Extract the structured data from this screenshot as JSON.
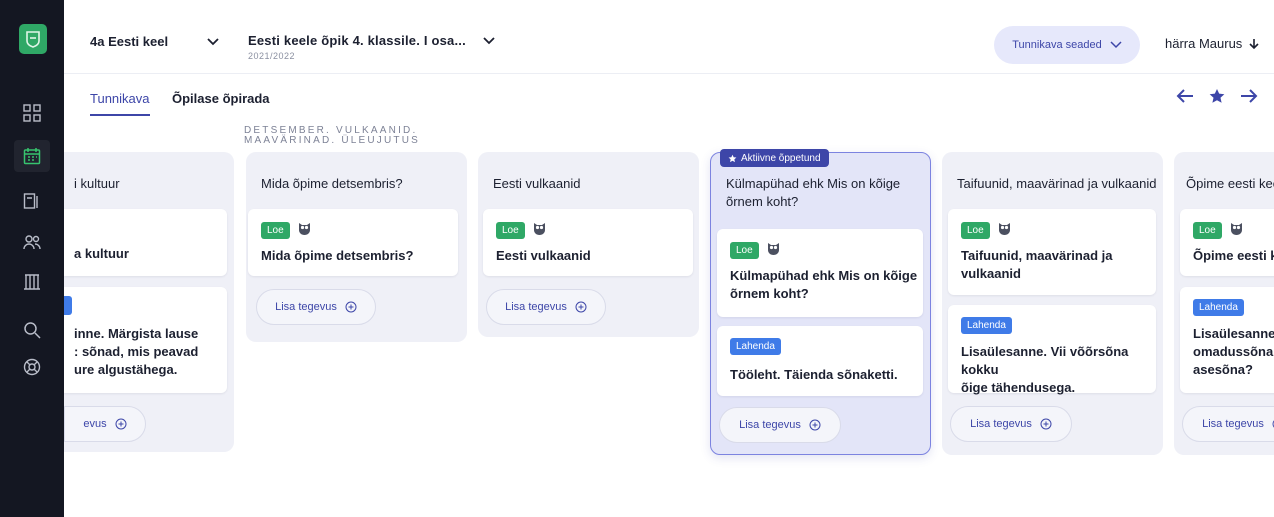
{
  "header": {
    "course": "4a Eesti keel",
    "book_title": "Eesti keele õpik 4. klassile. I osa...",
    "book_year": "2021/2022",
    "settings_label": "Tunnikava seaded",
    "user": "härra Maurus"
  },
  "tabs": [
    "Tunnikava",
    "Õpilase õpirada"
  ],
  "section_label_line1": "DETSEMBER. VULKAANID.",
  "section_label_line2": "MAAVÄRINAD. ÜLEUJUTUS",
  "active_badge": "Aktiivne õppetund",
  "add_label": "Lisa tegevus",
  "tags": {
    "read": "Loe",
    "solve": "Lahenda"
  },
  "columns": [
    {
      "title": "i kultuur",
      "cards": [
        {
          "tag": "",
          "text": "a kultuur"
        },
        {
          "tag": "Lahenda",
          "text_lines": [
            "inne. Märgista lause",
            ": sõnad, mis peavad",
            "ure algustähega."
          ]
        }
      ],
      "add": "evus"
    },
    {
      "title": "Mida õpime detsembris?",
      "cards": [
        {
          "tag": "Loe",
          "text": "Mida õpime detsembris?"
        }
      ],
      "add": "Lisa tegevus"
    },
    {
      "title": "Eesti vulkaanid",
      "cards": [
        {
          "tag": "Loe",
          "text": "Eesti vulkaanid"
        }
      ],
      "add": "Lisa tegevus"
    },
    {
      "title_lines": [
        "Külmapühad ehk Mis on kõige",
        "õrnem koht?"
      ],
      "cards": [
        {
          "tag": "Loe",
          "text_lines": [
            "Külmapühad ehk Mis on kõige",
            "õrnem koht?"
          ]
        },
        {
          "tag": "Lahenda",
          "text": "Tööleht. Täienda sõnaketti."
        }
      ],
      "add": "Lisa tegevus"
    },
    {
      "title": "Taifuunid, maavärinad ja vulkaanid",
      "cards": [
        {
          "tag": "Loe",
          "text_lines": [
            "Taifuunid, maavärinad ja",
            "vulkaanid"
          ]
        },
        {
          "tag": "Lahenda",
          "text_lines": [
            "Lisaülesanne. Vii võõrsõna kokku",
            "õige tähendusega."
          ]
        }
      ],
      "add": "Lisa tegevus"
    },
    {
      "title": "Õpime eesti kee",
      "cards": [
        {
          "tag": "Loe",
          "text": "Õpime eesti ke"
        },
        {
          "tag": "Lahenda",
          "text_lines": [
            "Lisaülesanne. I",
            "omadussõna, a",
            "asesõna?"
          ]
        }
      ],
      "add": "Lisa tegevus"
    }
  ],
  "colors": {
    "accent": "#3d46a8",
    "sidebar": "#141722",
    "green": "#2fa866",
    "blue": "#3f7be8"
  }
}
